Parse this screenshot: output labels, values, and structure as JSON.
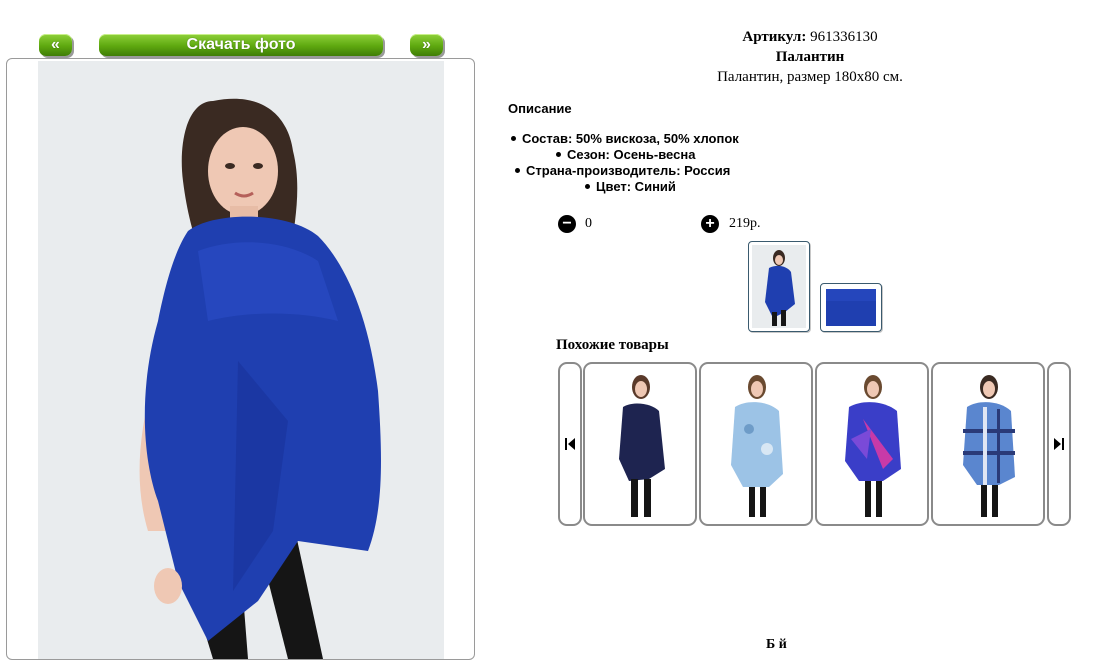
{
  "nav": {
    "prev_label": "«",
    "download_label": "Скачать фото",
    "next_label": "»"
  },
  "product": {
    "article_label": "Артикул:",
    "article_value": "961336130",
    "name": "Палантин",
    "short_desc": "Палантин, размер 180х80 см."
  },
  "description": {
    "heading": "Описание",
    "specs": [
      "Состав: 50% вискоза, 50% хлопок",
      "Сезон: Осень-весна",
      "Страна-производитель: Россия",
      "Цвет: Синий"
    ]
  },
  "order": {
    "minus_icon": "minus-circle-icon",
    "plus_icon": "plus-circle-icon",
    "quantity": "0",
    "price": "219р."
  },
  "similar": {
    "heading": "Похожие товары",
    "prev_icon": "skip-back-icon",
    "next_icon": "skip-forward-icon"
  },
  "footer": {
    "partial_text": "Б й"
  },
  "colors": {
    "button_green": "#5ea80f",
    "scarf_blue": "#1f3fb0",
    "frame_border": "#8a8a8a"
  }
}
